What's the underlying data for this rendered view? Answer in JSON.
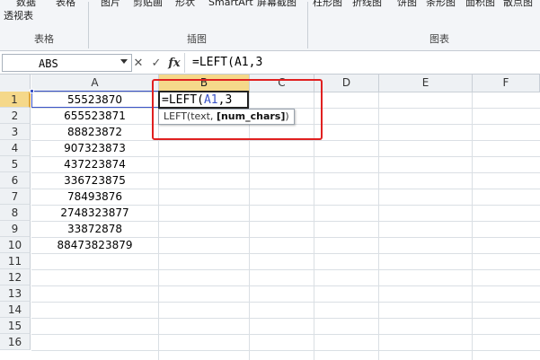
{
  "ribbon": {
    "items": [
      "数据",
      "表格",
      "图片",
      "剪贴画",
      "形状",
      "SmartArt",
      "屏幕截图",
      "柱形图",
      "折线图",
      "饼图",
      "条形图",
      "面积图",
      "散点图"
    ],
    "item_pivot_line2": "透视表",
    "groups": {
      "tables": "表格",
      "illustrations": "插图",
      "charts": "图表"
    }
  },
  "formula_bar": {
    "name_box": "ABS",
    "cancel_glyph": "✕",
    "enter_glyph": "✓",
    "insert_function_glyph": "fx",
    "formula_text": "=LEFT(A1,3"
  },
  "grid": {
    "columns": [
      "A",
      "B",
      "C",
      "D",
      "E",
      "F"
    ],
    "rows": [
      "1",
      "2",
      "3",
      "4",
      "5",
      "6",
      "7",
      "8",
      "9",
      "10",
      "11",
      "12",
      "13",
      "14",
      "15",
      "16"
    ],
    "column_a_values": [
      "55523870",
      "655523871",
      "88823872",
      "907323873",
      "437223874",
      "336723875",
      "78493876",
      "2748323877",
      "33872878",
      "88473823879"
    ],
    "active_column": "B",
    "active_row": "1",
    "edit_cell": {
      "prefix": "=LEFT(",
      "ref": "A1",
      "suffix": ",3"
    }
  },
  "tooltip": {
    "func": "LEFT(text, ",
    "arg_bold": "[num_chars]",
    "close": ")"
  },
  "colors": {
    "highlight_box": "#e02020",
    "selection": "#3b54c8",
    "active_header": "#f5d88a"
  }
}
